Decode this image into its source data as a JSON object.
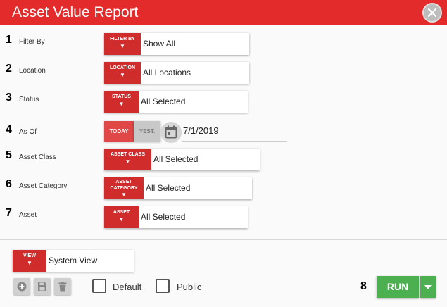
{
  "header": {
    "title": "Asset Value Report"
  },
  "rows": [
    {
      "num": "1",
      "label": "Filter By",
      "tag": "FILTER BY",
      "value": "Show All"
    },
    {
      "num": "2",
      "label": "Location",
      "tag": "LOCATION",
      "value": "All Locations"
    },
    {
      "num": "3",
      "label": "Status",
      "tag": "STATUS",
      "value": "All Selected"
    },
    {
      "num": "4",
      "label": "As Of",
      "today": "TODAY",
      "yesterday": "YEST.",
      "value": "7/1/2019"
    },
    {
      "num": "5",
      "label": "Asset Class",
      "tag": "ASSET CLASS",
      "value": "All Selected"
    },
    {
      "num": "6",
      "label": "Asset Category",
      "tag_line1": "ASSET",
      "tag_line2": "CATEGORY",
      "value": "All Selected"
    },
    {
      "num": "7",
      "label": "Asset",
      "tag": "ASSET",
      "value": "All Selected"
    }
  ],
  "view": {
    "tag": "VIEW",
    "value": "System View"
  },
  "options": {
    "default_label": "Default",
    "public_label": "Public"
  },
  "run": {
    "num": "8",
    "label": "RUN"
  },
  "icons": {
    "close": "close-icon",
    "calendar": "calendar-icon",
    "add": "add-icon",
    "save": "save-icon",
    "delete": "trash-icon",
    "dropdown": "caret-down-icon"
  },
  "colors": {
    "header": "#e32b2b",
    "tag": "#d12c2c",
    "run": "#4caf50"
  }
}
